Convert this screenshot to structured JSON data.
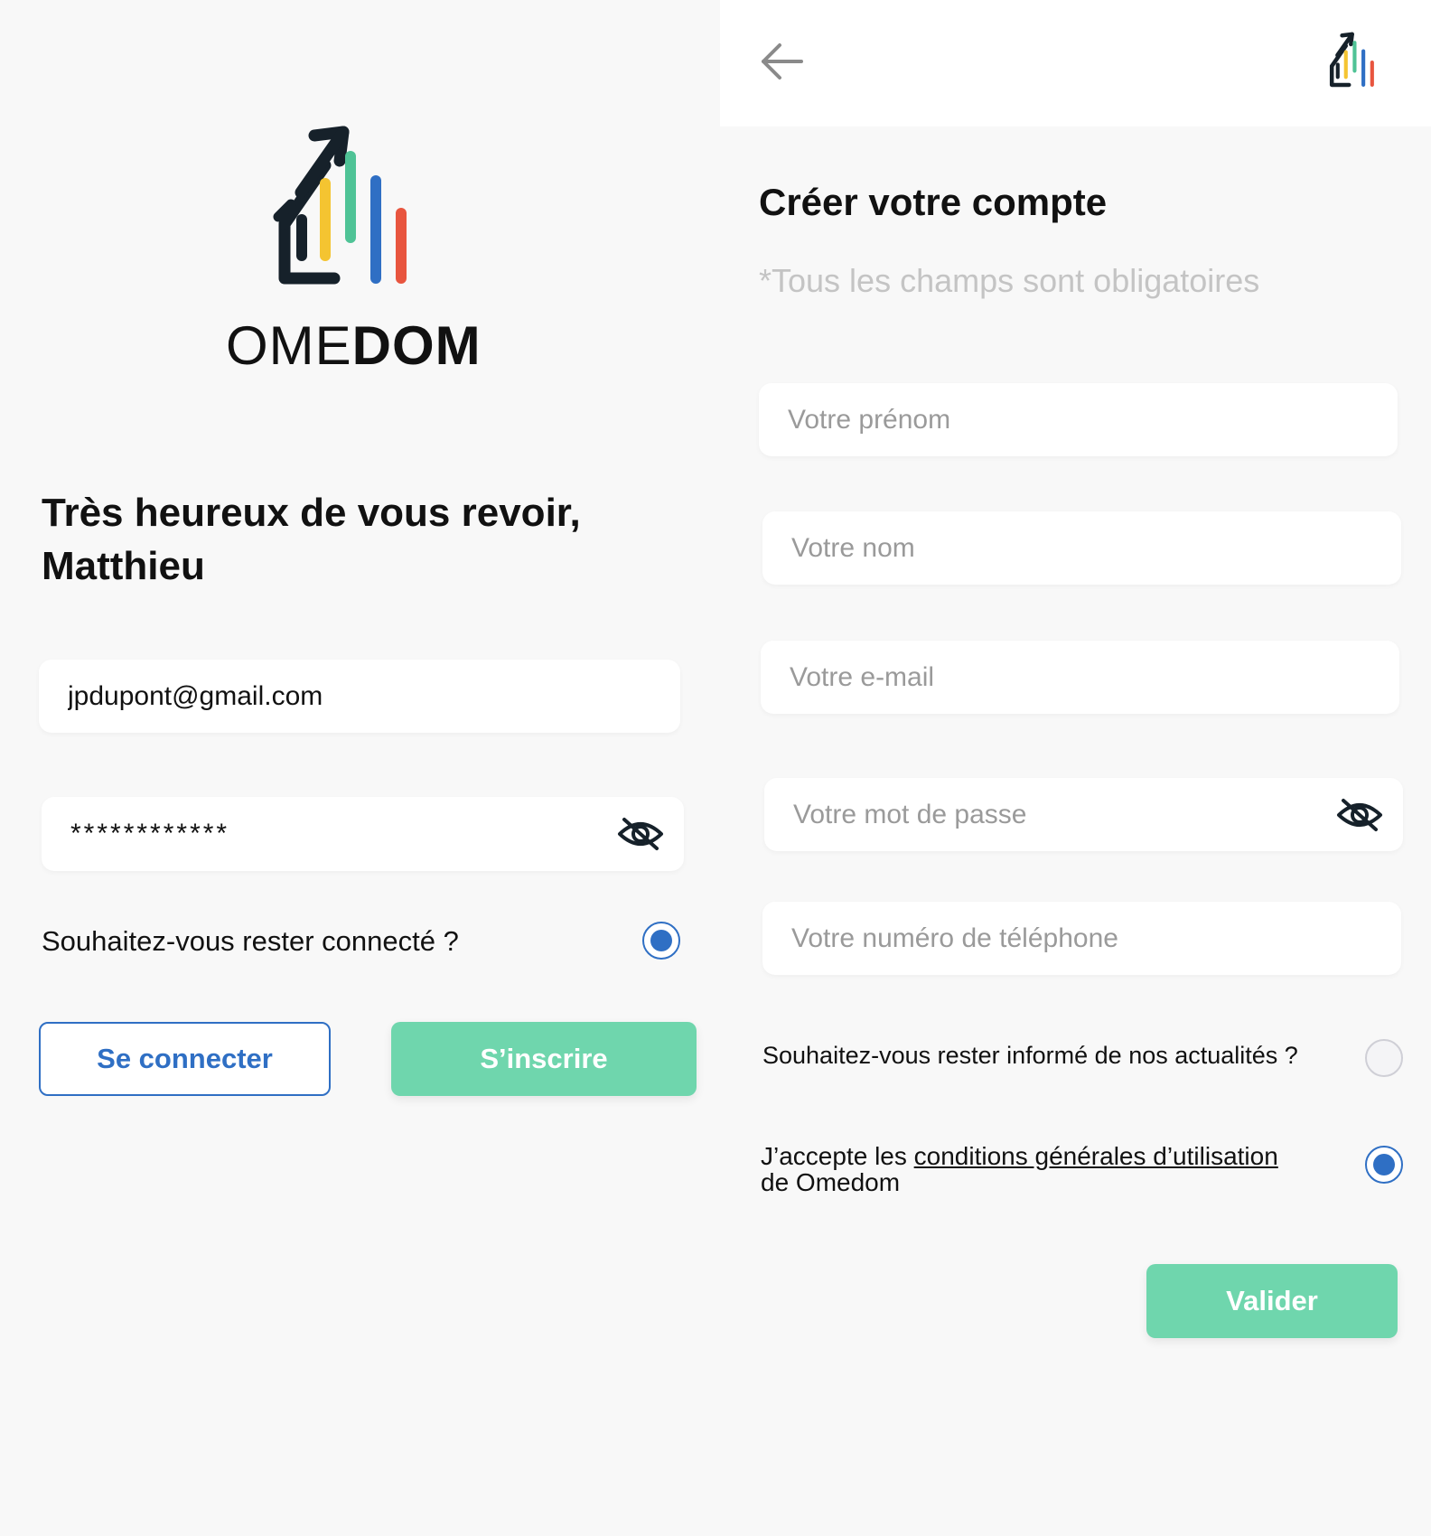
{
  "login": {
    "brand_light": "OME",
    "brand_bold": "DOM",
    "welcome_line1": "Très heureux de vous revoir,",
    "welcome_line2": "Matthieu",
    "email_value": "jpdupont@gmail.com",
    "password_value": "************",
    "remember_label": "Souhaitez-vous rester connecté ?",
    "remember_checked": true,
    "login_button": "Se connecter",
    "signup_button": "S’inscrire"
  },
  "signup": {
    "title": "Créer votre compte",
    "required_note": "*Tous les champs sont obligatoires",
    "firstname_placeholder": "Votre prénom",
    "lastname_placeholder": "Votre nom",
    "email_placeholder": "Votre e-mail",
    "password_placeholder": "Votre mot de passe",
    "phone_placeholder": "Votre numéro de téléphone",
    "newsletter_label": "Souhaitez-vous rester informé de nos actualités ?",
    "newsletter_checked": false,
    "cgu_prefix": "J’accepte les ",
    "cgu_link": "conditions générales d’utilisation",
    "cgu_suffix": " de Omedom",
    "cgu_checked": true,
    "validate_button": "Valider"
  },
  "colors": {
    "accent_blue": "#2f6fc4",
    "accent_green": "#6fd6ad",
    "logo_yellow": "#f4c431",
    "logo_green": "#4fc396",
    "logo_blue": "#2f6fc4",
    "logo_red": "#e8553f"
  }
}
